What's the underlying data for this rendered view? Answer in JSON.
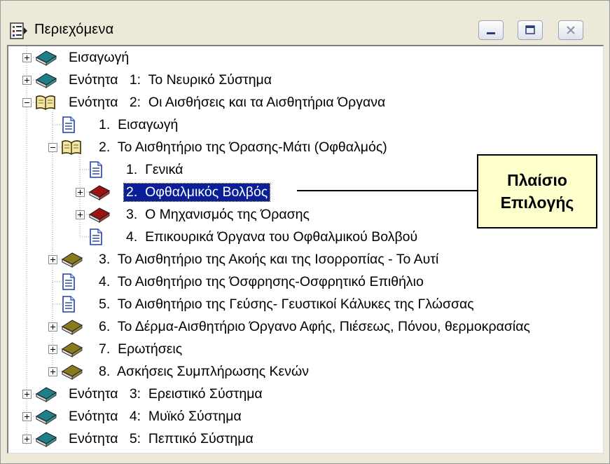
{
  "window": {
    "title": "Περιεχόμενα"
  },
  "tree": {
    "nodes": [
      {
        "label": "Εισαγωγή",
        "icon": "book-closed-teal-icon",
        "expander": "plus"
      },
      {
        "label": "Ενότητα   1:  Το Νευρικό Σύστημα",
        "icon": "book-closed-teal-icon",
        "expander": "plus"
      },
      {
        "label": "Ενότητα   2:  Οι Αισθήσεις και τα Αισθητήρια Όργανα",
        "icon": "book-open-icon",
        "expander": "minus"
      },
      {
        "label": "1.  Εισαγωγή",
        "icon": "document-icon",
        "expander": "none"
      },
      {
        "label": "2.  Το Αισθητήριο της Όρασης-Μάτι (Οφθαλμός)",
        "icon": "book-open-icon",
        "expander": "minus"
      },
      {
        "label": "1.  Γενικά",
        "icon": "document-icon",
        "expander": "none"
      },
      {
        "label": "2.  Οφθαλμικός Βολβός",
        "icon": "book-closed-red-icon",
        "expander": "plus",
        "selected": true
      },
      {
        "label": "3.  Ο Μηχανισμός της Όρασης",
        "icon": "book-closed-red-icon",
        "expander": "plus"
      },
      {
        "label": "4.  Επικουρικά Όργανα του Οφθαλμικού Βολβού",
        "icon": "document-icon",
        "expander": "none"
      },
      {
        "label": "3.  Το Αισθητήριο της Ακοής και της Ισορροπίας - Το Αυτί",
        "icon": "book-closed-olive-icon",
        "expander": "plus"
      },
      {
        "label": "4.  Το Αισθητήριο της Όσφρησης-Οσφρητικό Επιθήλιο",
        "icon": "document-icon",
        "expander": "none"
      },
      {
        "label": "5.  Το Αισθητήριο της Γεύσης- Γευστικοί Κάλυκες της Γλώσσας",
        "icon": "document-icon",
        "expander": "none"
      },
      {
        "label": "6.  Το Δέρμα-Αισθητήριο Όργανο Αφής, Πιέσεως, Πόνου, θερμοκρασίας",
        "icon": "book-closed-olive-icon",
        "expander": "plus"
      },
      {
        "label": "7.  Ερωτήσεις",
        "icon": "book-closed-olive-icon",
        "expander": "plus"
      },
      {
        "label": "8.  Ασκήσεις Συμπλήρωσης Κενών",
        "icon": "book-closed-olive-icon",
        "expander": "plus"
      },
      {
        "label": "Ενότητα   3:  Ερειστικό Σύστημα",
        "icon": "book-closed-teal-icon",
        "expander": "plus"
      },
      {
        "label": "Ενότητα   4:  Μυϊκό Σύστημα",
        "icon": "book-closed-teal-icon",
        "expander": "plus"
      },
      {
        "label": "Ενότητα   5:  Πεπτικό Σύστημα",
        "icon": "book-closed-teal-icon",
        "expander": "plus"
      }
    ]
  },
  "callout": {
    "line1": "Πλαίσιο",
    "line2": "Επιλογής"
  },
  "colors": {
    "selection": "#0a1f98",
    "callout_bg": "#ffffcc",
    "book_teal": "#1f7f86",
    "book_red": "#9c1414",
    "book_olive": "#8a7a1e"
  }
}
